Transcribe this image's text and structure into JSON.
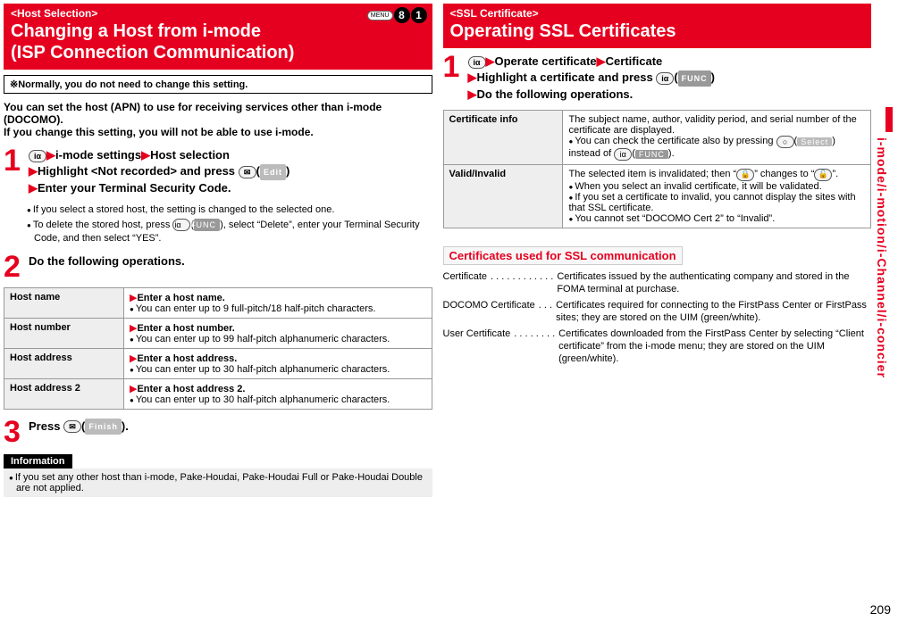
{
  "page_number": "209",
  "side_label": "i-mode/i-motion/i-Channel/i-concier",
  "left": {
    "banner_top": "<Host Selection>",
    "banner_title1": "Changing a Host from i-mode",
    "banner_title2": "(ISP Connection Communication)",
    "menu_chip": "MENU",
    "bubble1": "8",
    "bubble2": "1",
    "note": "※Normally, you do not need to change this setting.",
    "intro1": "You can set the host (APN) to use for receiving services other than i-mode (DOCOMO).",
    "intro2": "If you change this setting, you will not be able to use i-mode.",
    "step1": {
      "num": "1",
      "line1a": "i-mode settings",
      "line1b": "Host selection",
      "line2a": "Highlight <Not recorded> and press ",
      "line2_chip": "Edit",
      "line3": "Enter your Terminal Security Code."
    },
    "step1_bullets": [
      "If you select a stored host, the setting is changed to the selected one.",
      "To delete the stored host, press ",
      ", select “Delete”, enter your Terminal Security Code, and then select “YES”."
    ],
    "step2": {
      "num": "2",
      "text": "Do the following operations."
    },
    "table": [
      {
        "label": "Host name",
        "d1": "Enter a host name.",
        "d2": "You can enter up to 9 full-pitch/18 half-pitch characters."
      },
      {
        "label": "Host number",
        "d1": "Enter a host number.",
        "d2": "You can enter up to 99 half-pitch alphanumeric characters."
      },
      {
        "label": "Host address",
        "d1": "Enter a host address.",
        "d2": "You can enter up to 30 half-pitch alphanumeric characters."
      },
      {
        "label": "Host address 2",
        "d1": "Enter a host address 2.",
        "d2": "You can enter up to 30 half-pitch alphanumeric characters."
      }
    ],
    "step3": {
      "num": "3",
      "text": "Press ",
      "chip": "Finish",
      "close": "."
    },
    "info_heading": "Information",
    "info_bullet": "If you set any other host than i-mode, Pake-Houdai, Pake-Houdai Full or Pake-Houdai Double are not applied."
  },
  "right": {
    "banner_top": "<SSL Certificate>",
    "banner_title": "Operating SSL Certificates",
    "step1": {
      "num": "1",
      "seg1": "Operate certificate",
      "seg2": "Certificate",
      "seg3": "Highlight a certificate and press ",
      "func": "FUNC",
      "seg4": "Do the following operations."
    },
    "table": [
      {
        "label": "Certificate info",
        "lines": [
          {
            "plain": "The subject name, author, validity period, and serial number of the certificate are displayed."
          },
          {
            "bul": "You can check the certificate also by pressing ",
            "after_icon": "(",
            "chip": "Select",
            "close": ") instead of ",
            "chip2": "FUNC",
            "close2": ")."
          }
        ]
      },
      {
        "label": "Valid/Invalid",
        "lines": [
          {
            "plain": "The selected item is invalidated; then “",
            "mid_icon1": "🔒",
            "mid": "” changes to “",
            "mid_icon2": "🔓",
            "end": "”."
          },
          {
            "bul": "When you select an invalid certificate, it will be validated."
          },
          {
            "bul": "If you set a certificate to invalid, you cannot display the sites with that SSL certificate."
          },
          {
            "bul": "You cannot set “DOCOMO Cert 2” to “Invalid”."
          }
        ]
      }
    ],
    "sub_heading": "Certificates used for SSL communication",
    "defs": [
      {
        "term": "Certificate ",
        "dots": ". . . . . . . . . . . .",
        "def": "Certificates issued by the authenticating company and stored in the FOMA terminal at purchase."
      },
      {
        "term": "DOCOMO Certificate ",
        "dots": ". . .",
        "def": "Certificates required for connecting to the FirstPass Center or FirstPass sites; they are stored on the UIM (green/white)."
      },
      {
        "term": "User Certificate",
        "dots": ". . . . . . . .",
        "def": "Certificates downloaded from the FirstPass Center by selecting “Client certificate” from the i-mode menu; they are stored on the UIM (green/white)."
      }
    ]
  }
}
